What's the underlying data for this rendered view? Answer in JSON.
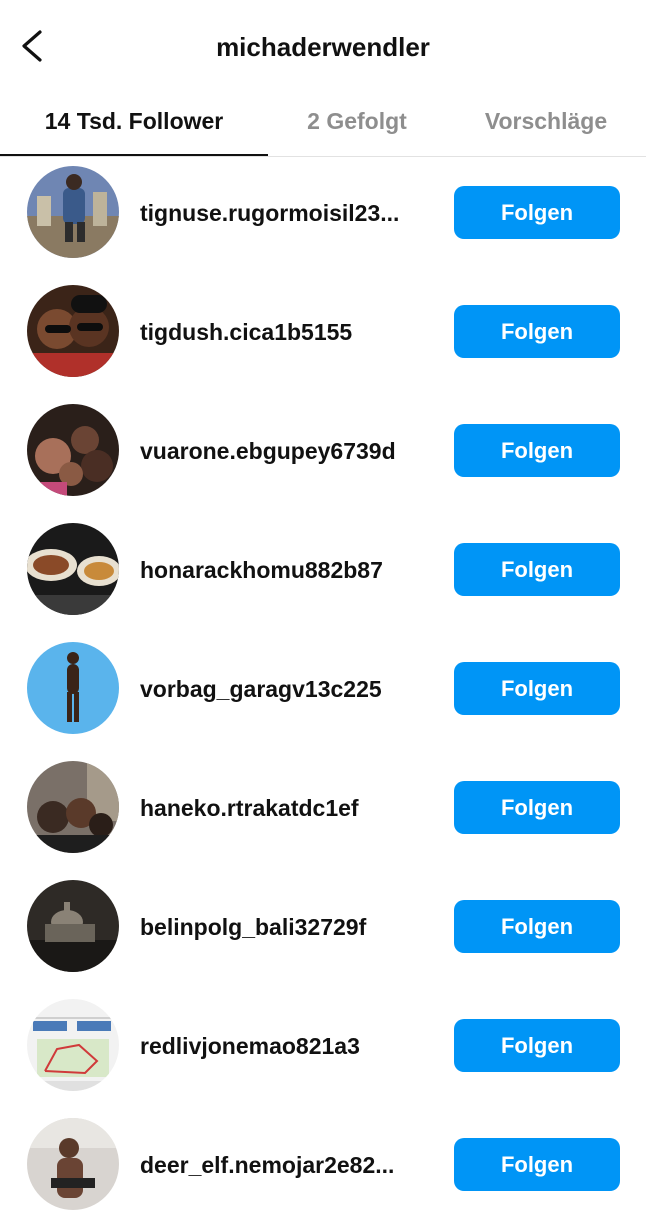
{
  "header": {
    "title": "michaderwendler",
    "back_icon": "chevron-left-icon"
  },
  "tabs": [
    {
      "label": "14 Tsd. Follower",
      "active": true
    },
    {
      "label": "2 Gefolgt",
      "active": false
    },
    {
      "label": "Vorschläge",
      "active": false
    }
  ],
  "followers": [
    {
      "username": "tignuse.rugormoisil23...",
      "button": "Folgen"
    },
    {
      "username": "tigdush.cica1b5155",
      "button": "Folgen"
    },
    {
      "username": "vuarone.ebgupey6739d",
      "button": "Folgen"
    },
    {
      "username": "honarackhomu882b87",
      "button": "Folgen"
    },
    {
      "username": "vorbag_garagv13c225",
      "button": "Folgen"
    },
    {
      "username": "haneko.rtrakatdc1ef",
      "button": "Folgen"
    },
    {
      "username": "belinpolg_bali32729f",
      "button": "Folgen"
    },
    {
      "username": "redlivjonemao821a3",
      "button": "Folgen"
    },
    {
      "username": "deer_elf.nemojar2e82...",
      "button": "Folgen"
    }
  ],
  "colors": {
    "accent": "#0095f6",
    "text": "#111111",
    "muted": "#8e8e8e"
  }
}
